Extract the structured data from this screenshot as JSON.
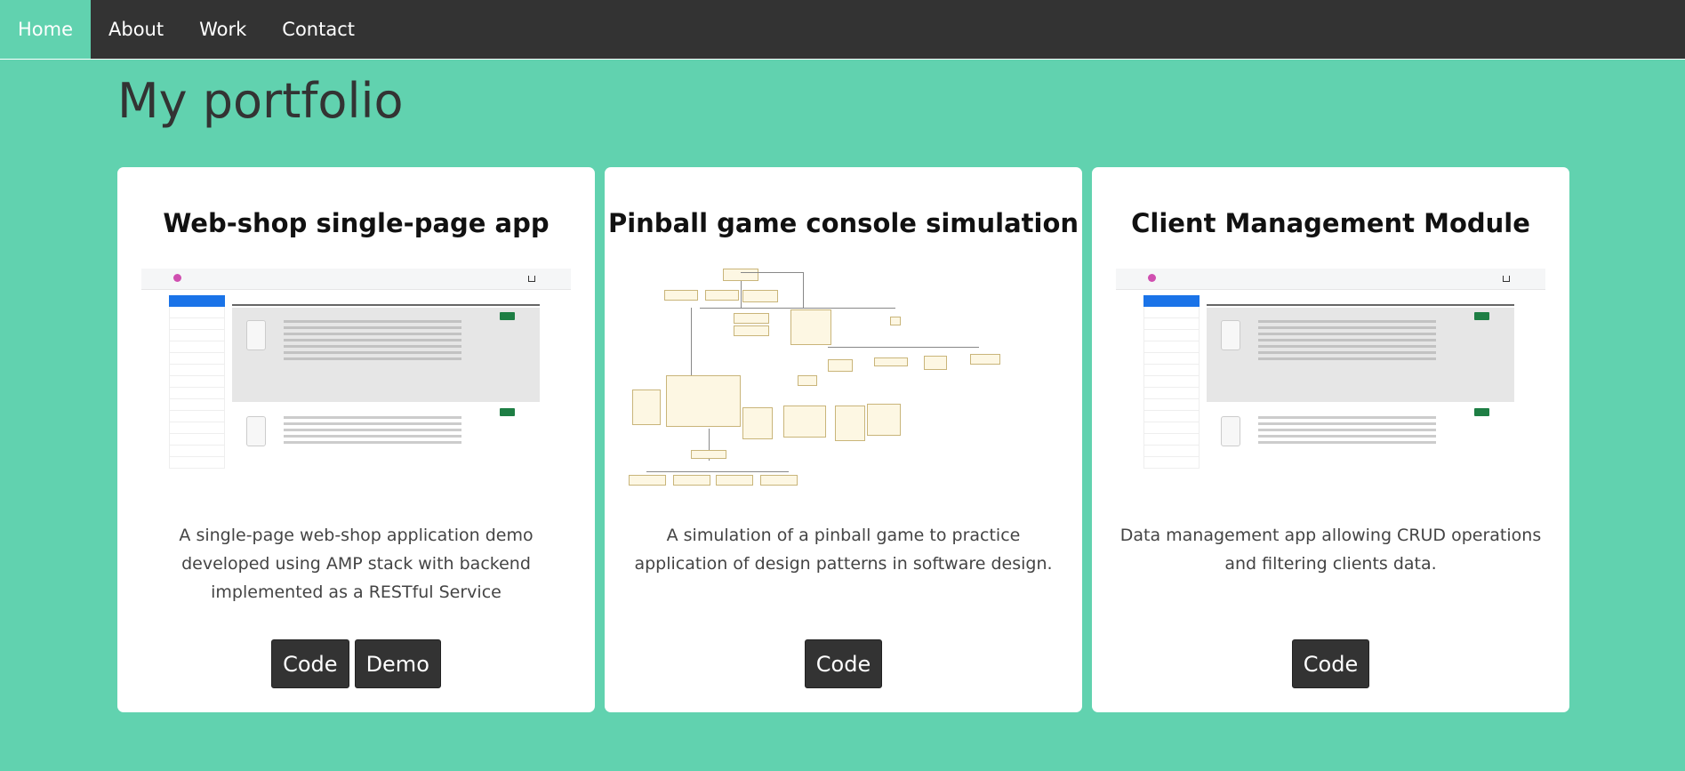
{
  "nav": {
    "items": [
      {
        "label": "Home",
        "active": true
      },
      {
        "label": "About",
        "active": false
      },
      {
        "label": "Work",
        "active": false
      },
      {
        "label": "Contact",
        "active": false
      }
    ]
  },
  "page": {
    "title": "My portfolio"
  },
  "cards": [
    {
      "title": "Web-shop single-page app",
      "description": "A single-page web-shop application demo developed using AMP stack with backend implemented as a RESTful Service",
      "buttons": [
        "Code",
        "Demo"
      ]
    },
    {
      "title": "Pinball game console simulation",
      "description": "A simulation of a pinball game to practice application of design patterns in software design.",
      "buttons": [
        "Code"
      ]
    },
    {
      "title": "Client Management Module",
      "description": "Data management app allowing CRUD operations and filtering clients data.",
      "buttons": [
        "Code"
      ]
    }
  ],
  "colors": {
    "background": "#61d2af",
    "nav": "#333333",
    "button": "#333333",
    "card": "#ffffff"
  }
}
